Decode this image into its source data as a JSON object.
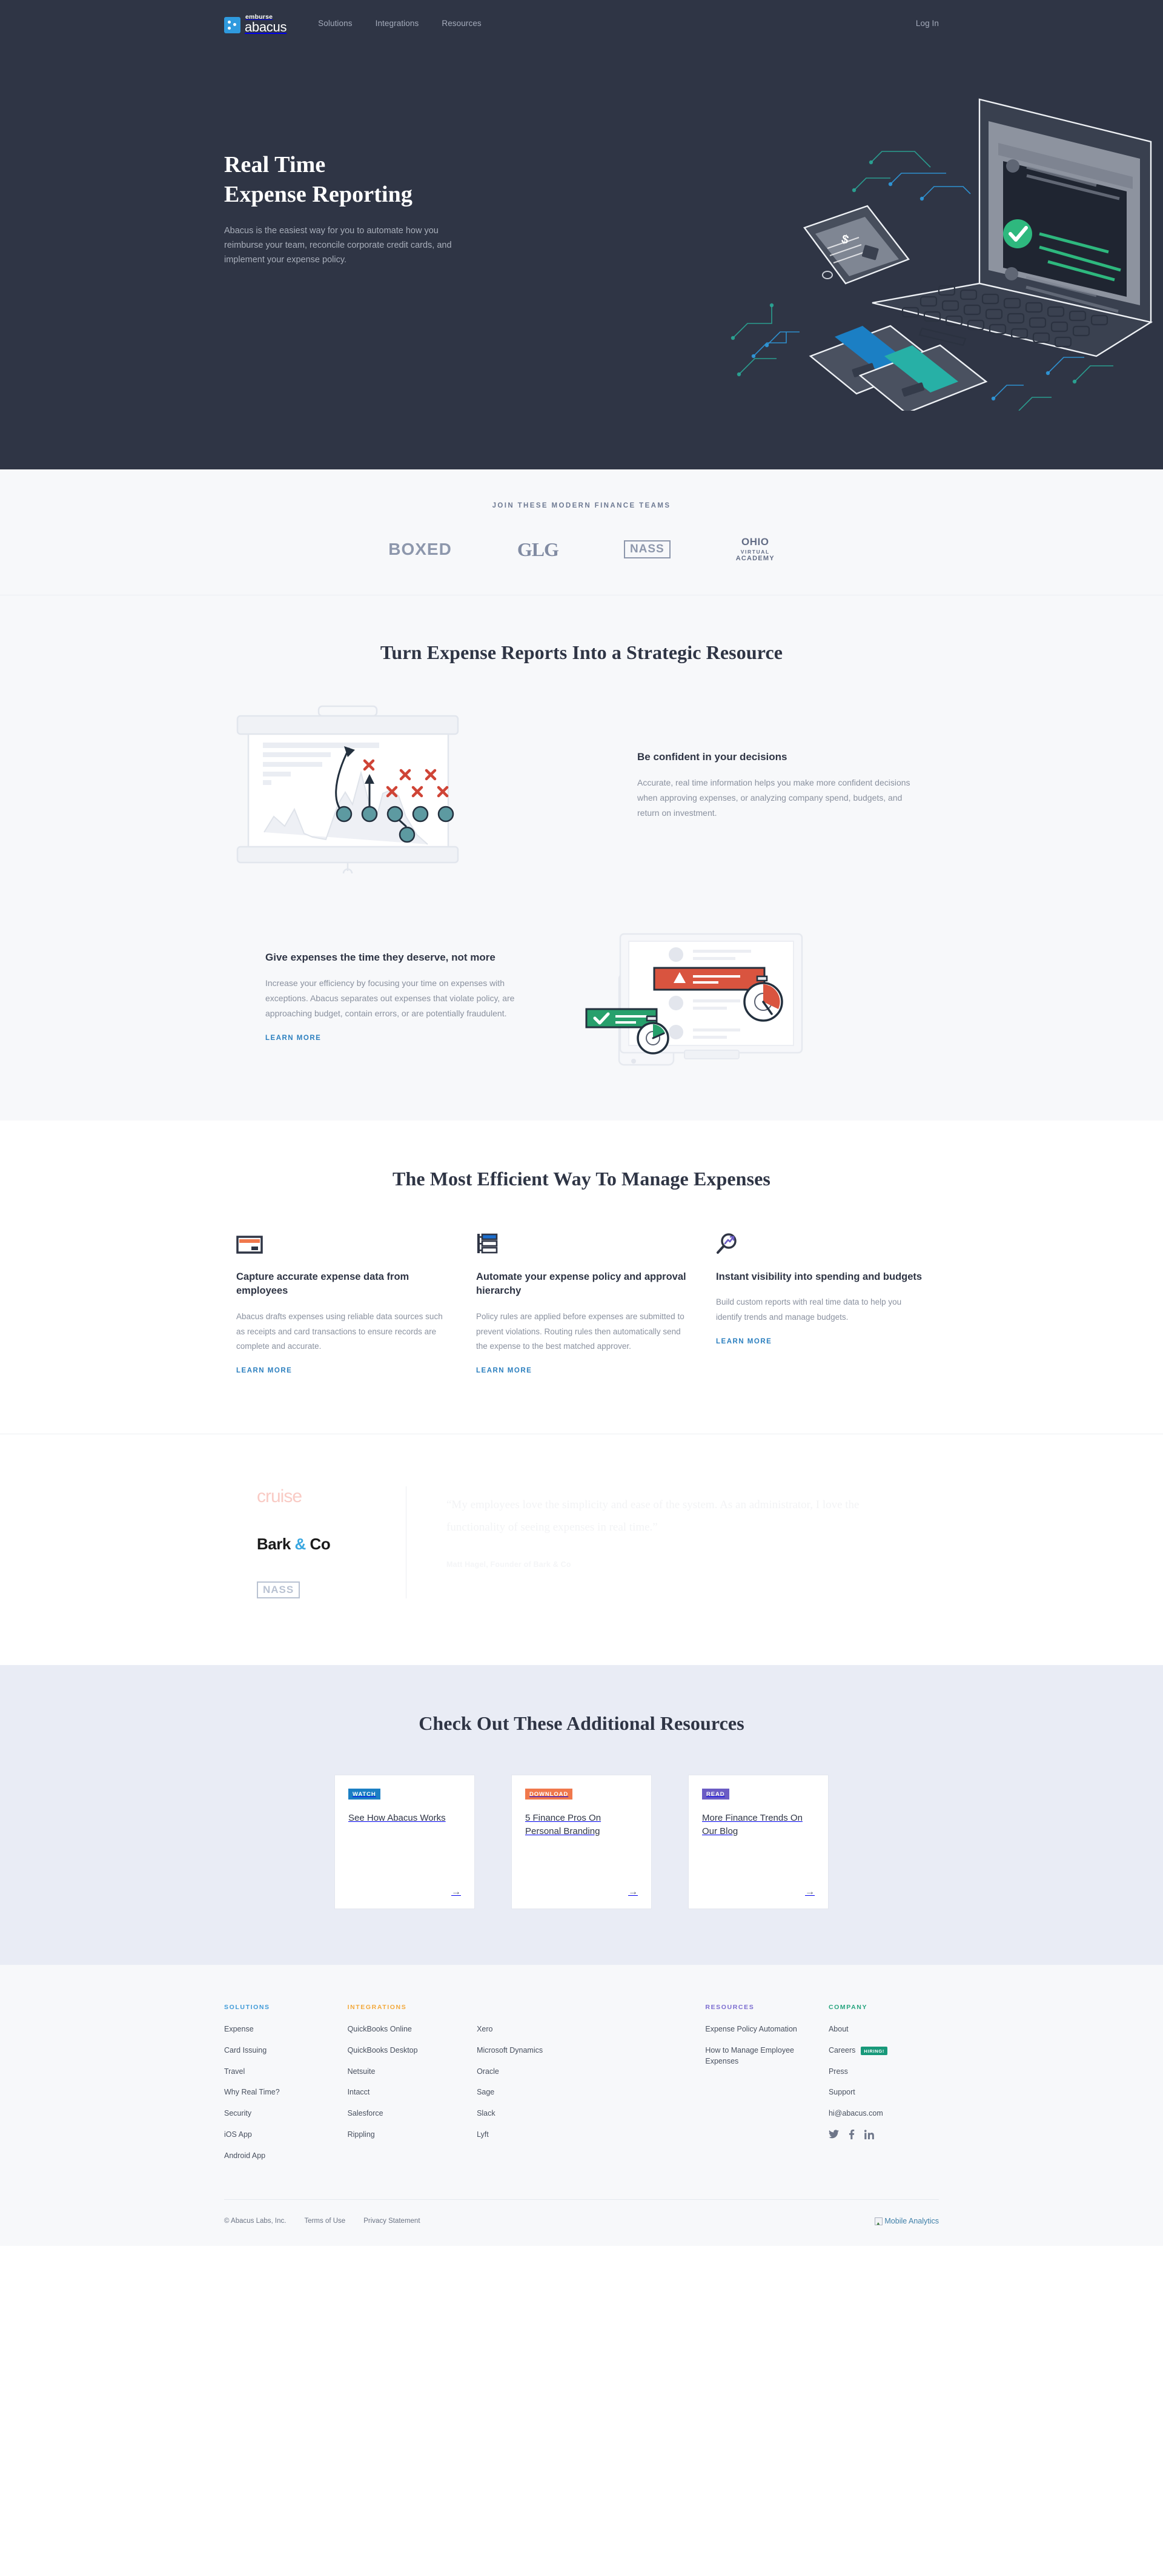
{
  "nav": {
    "logo_sup": "emburse",
    "logo_main": "abacus",
    "links": [
      "Solutions",
      "Integrations",
      "Resources"
    ],
    "login": "Log In"
  },
  "hero": {
    "title_line1": "Real Time",
    "title_line2": "Expense Reporting",
    "subtitle": "Abacus is the easiest way for you to automate how you reimburse your team, reconcile corporate credit cards, and implement your expense policy."
  },
  "logostrip": {
    "eyebrow": "JOIN THESE MODERN FINANCE TEAMS",
    "logos": [
      {
        "name": "BOXED"
      },
      {
        "name": "GLG"
      },
      {
        "name": "NASS"
      },
      {
        "name": "OHIO",
        "line2": "VIRTUAL",
        "line3": "ACADEMY"
      }
    ]
  },
  "strategic": {
    "title": "Turn Expense Reports Into a Strategic Resource",
    "features": [
      {
        "heading": "Be confident in your decisions",
        "body": "Accurate, real time information helps you make more confident decisions when approving expenses, or analyzing company spend, budgets, and return on investment.",
        "link": ""
      },
      {
        "heading": "Give expenses the time they deserve, not more",
        "body": "Increase your efficiency by focusing your time on expenses with exceptions. Abacus separates out expenses that violate policy, are approaching budget, contain errors, or are potentially fraudulent.",
        "link": "LEARN MORE"
      }
    ]
  },
  "efficient": {
    "title": "The Most Efficient Way To Manage Expenses",
    "columns": [
      {
        "icon": "credit-card-icon",
        "heading": "Capture accurate expense data from employees",
        "body": "Abacus drafts expenses using reliable data sources such as receipts and card transactions to ensure records are complete and accurate.",
        "link": "LEARN MORE"
      },
      {
        "icon": "hierarchy-icon",
        "heading": "Automate your expense policy and approval hierarchy",
        "body": "Policy rules are applied before expenses are submitted to prevent violations. Routing rules then automatically send the expense to the best matched approver.",
        "link": "LEARN MORE"
      },
      {
        "icon": "magnifier-trend-icon",
        "heading": "Instant visibility into spending and budgets",
        "body": "Build custom reports with real time data to help you identify trends and manage budgets.",
        "link": "LEARN MORE"
      }
    ]
  },
  "testimonial": {
    "logos": [
      "cruise",
      "Bark & Co",
      "NASS"
    ],
    "quote": "“My employees love the simplicity and ease of the system. As an administrator, I love the functionality of seeing expenses in real time.”",
    "author": "Matt Hagel, Founder of Bark & Co"
  },
  "resources": {
    "title": "Check Out These Additional Resources",
    "cards": [
      {
        "tag": "WATCH",
        "tag_color": "#1b7fc4",
        "title": "See How Abacus Works",
        "arrow": "→"
      },
      {
        "tag": "DOWNLOAD",
        "tag_color": "#f0784c",
        "title": "5 Finance Pros On Personal Branding",
        "arrow": "→"
      },
      {
        "tag": "READ",
        "tag_color": "#6b5cc4",
        "title": "More Finance Trends On Our Blog",
        "arrow": "→"
      }
    ]
  },
  "footer": {
    "solutions": {
      "heading": "SOLUTIONS",
      "color": "#3f9ad8",
      "items": [
        "Expense",
        "Card Issuing",
        "Travel",
        "Why Real Time?",
        "Security",
        "iOS App",
        "Android App"
      ]
    },
    "integrations": {
      "heading": "INTEGRATIONS",
      "color": "#f3a93c",
      "col_a": [
        "QuickBooks Online",
        "QuickBooks Desktop",
        "Netsuite",
        "Intacct",
        "Salesforce",
        "Rippling"
      ],
      "col_b": [
        "Xero",
        "Microsoft Dynamics",
        "Oracle",
        "Sage",
        "Slack",
        "Lyft"
      ]
    },
    "resources": {
      "heading": "RESOURCES",
      "color": "#7b6cd0",
      "items": [
        "Expense Policy Automation",
        "How to Manage Employee Expenses"
      ]
    },
    "company": {
      "heading": "COMPANY",
      "color": "#28a57f",
      "items": [
        "About",
        "Press",
        "Support",
        "hi@abacus.com"
      ],
      "careers_label": "Careers",
      "hiring_badge": "HIRING!",
      "social": [
        "twitter-icon",
        "facebook-icon",
        "linkedin-icon"
      ]
    },
    "bottom": {
      "copyright": "© Abacus Labs, Inc.",
      "links": [
        "Terms of Use",
        "Privacy Statement"
      ],
      "analytics_alt": "Mobile Analytics"
    }
  }
}
